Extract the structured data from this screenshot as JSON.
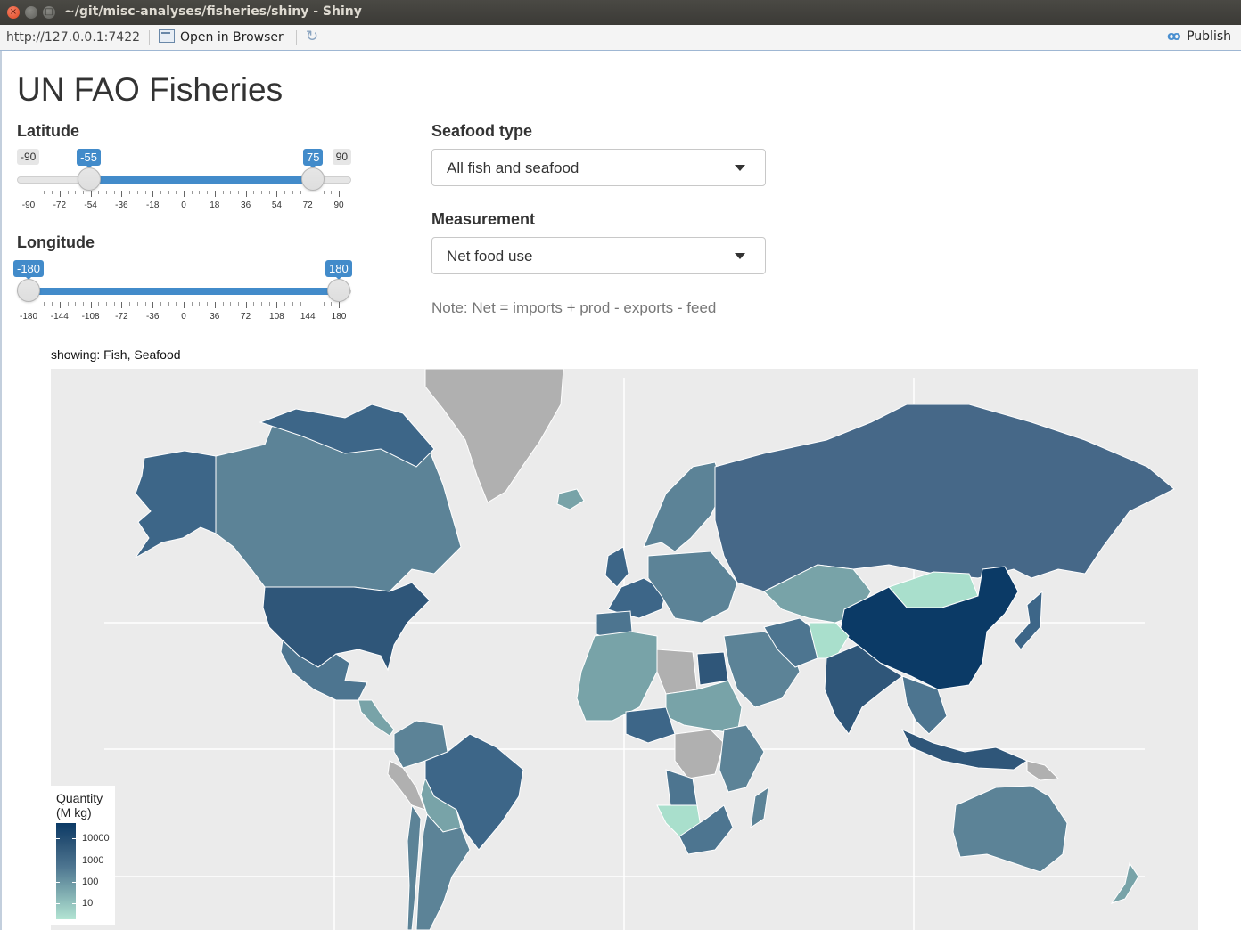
{
  "window": {
    "title": "~/git/misc-analyses/fisheries/shiny - Shiny",
    "close_glyph": "×",
    "min_glyph": "–",
    "max_glyph": "□"
  },
  "addressbar": {
    "url": "http://127.0.0.1:7422",
    "open_in_browser": "Open in Browser",
    "refresh_icon": "↻",
    "publish_label": "Publish",
    "publish_icon": "ꝏ"
  },
  "app": {
    "title": "UN FAO Fisheries",
    "latitude": {
      "label": "Latitude",
      "min": "-90",
      "max": "90",
      "from": "-55",
      "to": "75",
      "range": [
        -90,
        90
      ],
      "value": [
        -55,
        75
      ],
      "ticks": [
        "-90",
        "-72",
        "-54",
        "-36",
        "-18",
        "0",
        "18",
        "36",
        "54",
        "72",
        "90"
      ]
    },
    "longitude": {
      "label": "Longitude",
      "from": "-180",
      "to": "180",
      "range": [
        -180,
        180
      ],
      "value": [
        -180,
        180
      ],
      "ticks": [
        "-180",
        "-144",
        "-108",
        "-72",
        "-36",
        "0",
        "36",
        "72",
        "108",
        "144",
        "180"
      ]
    },
    "seafood_type": {
      "label": "Seafood type",
      "selected": "All fish and seafood"
    },
    "measurement": {
      "label": "Measurement",
      "selected": "Net food use"
    },
    "note": "Note: Net = imports + prod - exports - feed"
  },
  "map": {
    "subtitle": "showing: Fish, Seafood",
    "legend": {
      "title_line1": "Quantity",
      "title_line2": "(M kg)",
      "labels": [
        "10000",
        "1000",
        "100",
        "10"
      ]
    },
    "colors": {
      "background": "#ebebeb",
      "no_data": "#b0b0b0",
      "very_high": "#0b3a66",
      "high": "#3d6688",
      "mid": "#5c8397",
      "low": "#78a3a8",
      "very_low": "#a9dfcc"
    }
  }
}
